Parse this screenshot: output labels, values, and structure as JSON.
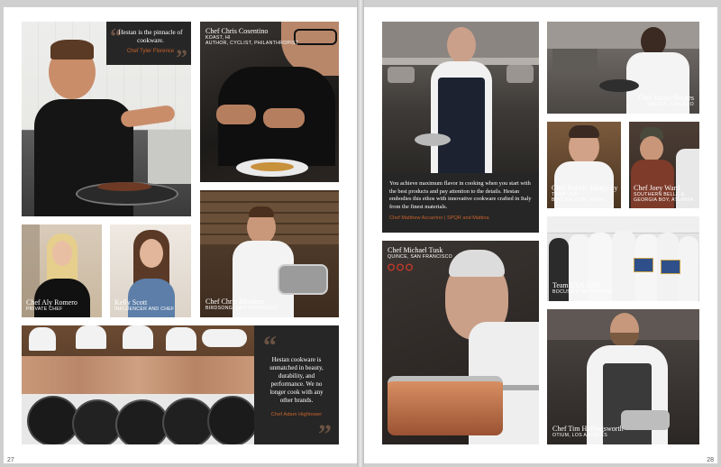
{
  "pages": {
    "left_number": "27",
    "right_number": "28"
  },
  "quotes": {
    "tyler": {
      "text": "Hestan is the pinnacle of cookware.",
      "author": "Chef Tyler Florence"
    },
    "adam": {
      "text": "Hestan cookware is unmatched in beauty, durability, and performance. We no longer cook with any other brands.",
      "author": "Chef Adam Hightower"
    },
    "matthew": {
      "text": "You achieve maximum flavor in cooking when you start with the best products and pay attention to the details. Hestan embodies this ethos with innovative cookware crafted in Italy from the finest materials.",
      "author": "Chef Matthew Accarrino  |  SPQR and Mattina"
    }
  },
  "chefs": {
    "cosentino": {
      "name": "Chef Chris Cosentino",
      "sub": "KOAST, HI",
      "sub2": "AUTHOR, CYCLIST, PHILANTHROPIST"
    },
    "aly": {
      "name": "Chef Aly Romero",
      "sub": "PRIVATE CHEF"
    },
    "kelly": {
      "name": "Kelly Scott",
      "sub": "INFLUENCER AND CHEF"
    },
    "bleidorn": {
      "name": "Chef Chris Bleidorn",
      "sub": "BIRDSONG, SAN FRANCISCO"
    },
    "borges": {
      "name": "Chef Junior Borges",
      "sub": "JUNIPER, CHICAGO"
    },
    "sulatycky": {
      "name": "Chef Robert Sulatycky",
      "sub": "TEAM USA",
      "sub2": "BOCUSE D'OR, NAPA"
    },
    "ward": {
      "name": "Chef Joey Ward",
      "sub": "SOUTHERN BELLE &",
      "sub2": "GEORGIA BOY, ATLANTA"
    },
    "teamusa": {
      "name": "Team USA 2025",
      "sub": "BOCUSE D'OR, MENTOR"
    },
    "tusk": {
      "name": "Chef Michael Tusk",
      "sub": "QUINCE, SAN FRANCISCO"
    },
    "hollingsworth": {
      "name": "Chef Tim Hollingsworth",
      "sub": "OTIUM, LOS ANGELES"
    }
  },
  "icons": {
    "quote": "quotation-mark-icon",
    "stars": "michelin-stars-icon"
  },
  "colors": {
    "quote_accent": "#c7622b",
    "dark_panel": "#262626"
  }
}
